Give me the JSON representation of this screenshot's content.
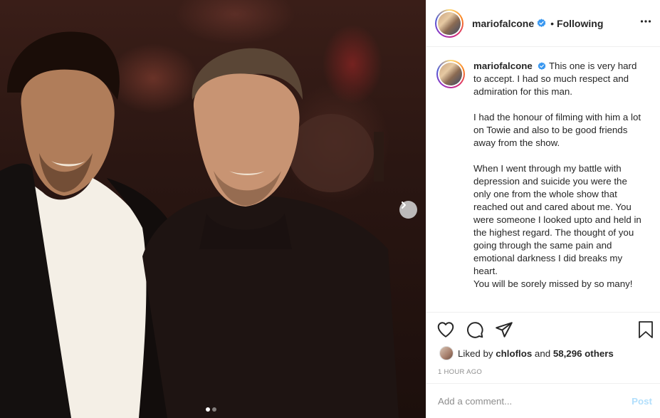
{
  "post": {
    "username": "mariofalcone",
    "follow_status": "Following",
    "separator": "•",
    "verified": true
  },
  "caption": {
    "username": "mariofalcone",
    "paragraphs": [
      "This one is very hard to accept. I had so much respect and admiration for this man.",
      "I had the honour of filming with him a lot on Towie and also to be good friends away from the show.",
      "When I went through my battle with depression and suicide you were the only one from the whole show that reached out and cared about me. You were someone I looked upto and held in the highest regard. The thought of you going through the same pain and emotional darkness I did breaks my heart.",
      "You will be sorely missed by so many!"
    ]
  },
  "likes": {
    "prefix": "Liked by",
    "user": "chloflos",
    "and": "and",
    "count": "58,296 others"
  },
  "timestamp": "1 hour ago",
  "comment": {
    "placeholder": "Add a comment...",
    "post_label": "Post"
  },
  "carousel": {
    "total": 2,
    "current": 1
  },
  "icons": {
    "like": "heart-icon",
    "comment": "comment-bubble-icon",
    "share": "paper-plane-icon",
    "save": "bookmark-icon",
    "more": "more-options-icon",
    "next": "chevron-right-icon",
    "verified": "verified-badge-icon"
  },
  "colors": {
    "verified": "#3897f0",
    "post_button": "#b2dffc",
    "muted_text": "#8e8e8e",
    "border": "#efefef"
  }
}
